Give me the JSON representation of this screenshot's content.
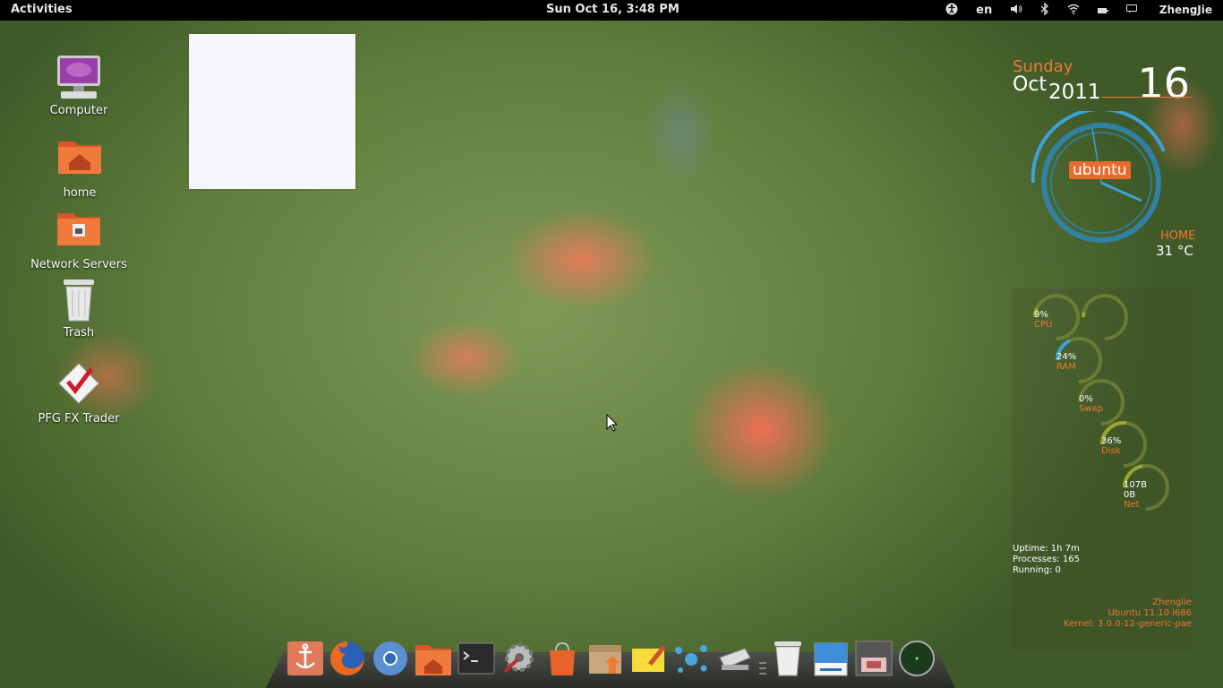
{
  "topbar": {
    "activities": "Activities",
    "clock": "Sun Oct 16,  3:48 PM",
    "tray": {
      "accessibility_icon": "accessibility-icon",
      "language": "en",
      "volume_icon": "volume-icon",
      "bluetooth_icon": "bluetooth-icon",
      "wifi_icon": "wifi-icon",
      "battery_icon": "battery-icon",
      "user": "ZhengJie"
    }
  },
  "desktop": {
    "icons": [
      {
        "label": "Computer",
        "icon": "computer-icon"
      },
      {
        "label": "home",
        "icon": "home-folder-icon"
      },
      {
        "label": "Network Servers",
        "icon": "network-folder-icon"
      },
      {
        "label": "Trash",
        "icon": "trash-icon"
      },
      {
        "label": "PFG FX Trader",
        "icon": "fx-trader-icon"
      }
    ]
  },
  "conky": {
    "day_name": "Sunday",
    "month": "Oct",
    "year": "2011",
    "day_num": "16",
    "logo_text": "ubuntu",
    "location": "HOME",
    "temperature": "31 °C",
    "rings": [
      {
        "value": "9%",
        "label": "CPU",
        "fraction": 0.09
      },
      {
        "value": "",
        "label": "",
        "fraction": 0.05
      },
      {
        "value": "24%",
        "label": "RAM",
        "fraction": 0.24
      },
      {
        "value": "0%",
        "label": "Swap",
        "fraction": 0.0
      },
      {
        "value": "36%",
        "label": "Disk",
        "fraction": 0.36
      },
      {
        "value": "107B",
        "value2": "0B",
        "label": "Net",
        "fraction": 0.3
      }
    ],
    "uptime": "Uptime: 1h 7m",
    "processes": "Processes: 165",
    "running": "Running: 0",
    "user": "Zhenglie",
    "os": "Ubuntu 11.10  i686",
    "kernel": "Kernel: 3.0.0-12-generic-pae"
  },
  "dock": {
    "items": [
      "anchor-icon",
      "firefox-icon",
      "chromium-icon",
      "home-folder-icon",
      "terminal-icon",
      "system-settings-icon",
      "software-center-icon",
      "package-icon",
      "notes-icon",
      "splash-icon",
      "scanner-icon",
      "separator",
      "trash-icon",
      "file-manager-icon",
      "screenshot-icon",
      "radar-icon"
    ]
  },
  "colors": {
    "accent": "#f07830",
    "gauge_blue": "#3aa3d8",
    "ring_green": "#9aa62c"
  }
}
